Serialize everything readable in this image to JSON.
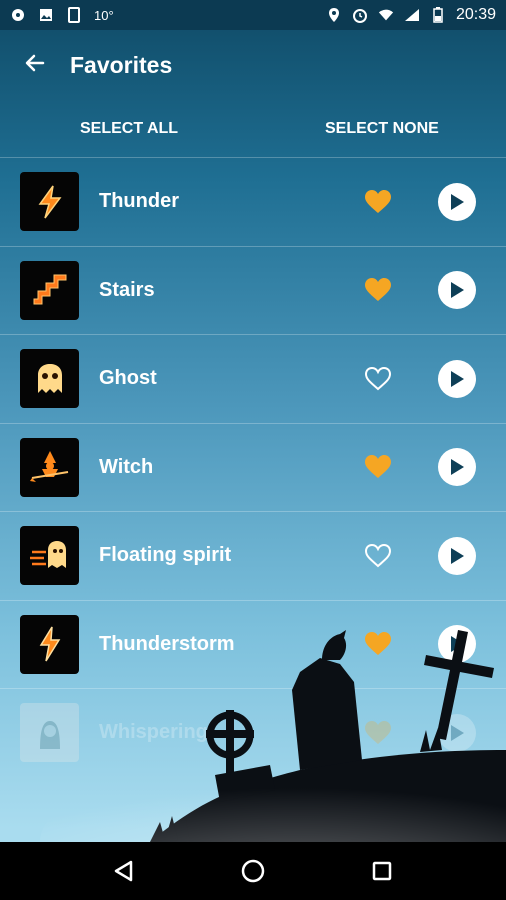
{
  "status_bar": {
    "temperature": "10°",
    "time": "20:39"
  },
  "app_bar": {
    "title": "Favorites",
    "back_icon": "arrow-left-icon"
  },
  "selection": {
    "select_all": "SELECT ALL",
    "select_none": "SELECT NONE"
  },
  "sounds": [
    {
      "name": "Thunder",
      "favorite": true,
      "icon": "lightning-icon"
    },
    {
      "name": "Stairs",
      "favorite": true,
      "icon": "stairs-icon"
    },
    {
      "name": "Ghost",
      "favorite": false,
      "icon": "ghost-icon"
    },
    {
      "name": "Witch",
      "favorite": true,
      "icon": "witch-icon"
    },
    {
      "name": "Floating spirit",
      "favorite": false,
      "icon": "spirit-icon"
    },
    {
      "name": "Thunderstorm",
      "favorite": true,
      "icon": "thunderstorm-icon"
    },
    {
      "name": "Whispering",
      "favorite": true,
      "icon": "woman-icon"
    }
  ],
  "colors": {
    "favorite": "#f5a623",
    "accent_bg": "#1f6f93"
  }
}
